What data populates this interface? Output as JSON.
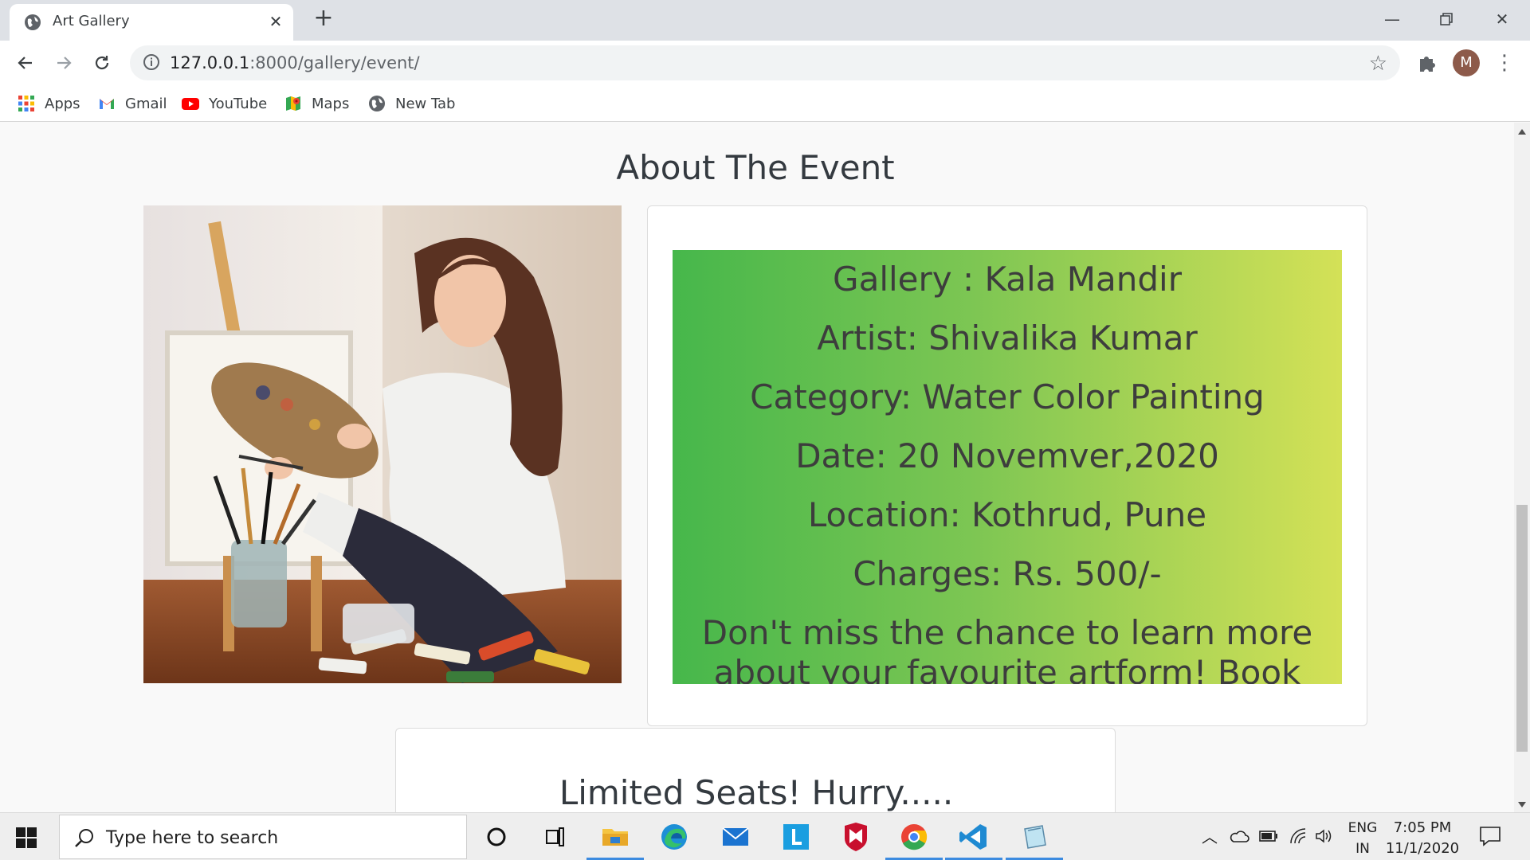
{
  "browser": {
    "tab_title": "Art Gallery",
    "url_host": "127.0.0.1",
    "url_path": ":8000/gallery/event/",
    "avatar_letter": "M",
    "bookmarks": [
      {
        "label": "Apps",
        "icon": "apps-grid-icon"
      },
      {
        "label": "Gmail",
        "icon": "gmail-icon"
      },
      {
        "label": "YouTube",
        "icon": "youtube-icon"
      },
      {
        "label": "Maps",
        "icon": "maps-icon"
      },
      {
        "label": "New Tab",
        "icon": "globe-icon"
      }
    ]
  },
  "page": {
    "heading": "About The Event",
    "event": {
      "gallery": "Gallery : Kala Mandir",
      "artist": "Artist: Shivalika Kumar",
      "category": "Category: Water Color Painting",
      "date": "Date: 20 Novemver,2020",
      "location": "Location: Kothrud, Pune",
      "charges": "Charges: Rs. 500/-",
      "cta": "Don't miss the chance to learn more about your favourite artform! Book Now!"
    },
    "seats_title": "Limited Seats! Hurry.....",
    "colors": {
      "gradient_start": "#46b74b",
      "gradient_end": "#d4e157",
      "heading": "#343a40"
    }
  },
  "taskbar": {
    "search_placeholder": "Type here to search",
    "lang_top": "ENG",
    "lang_bottom": "IN",
    "time": "7:05 PM",
    "date": "11/1/2020"
  }
}
